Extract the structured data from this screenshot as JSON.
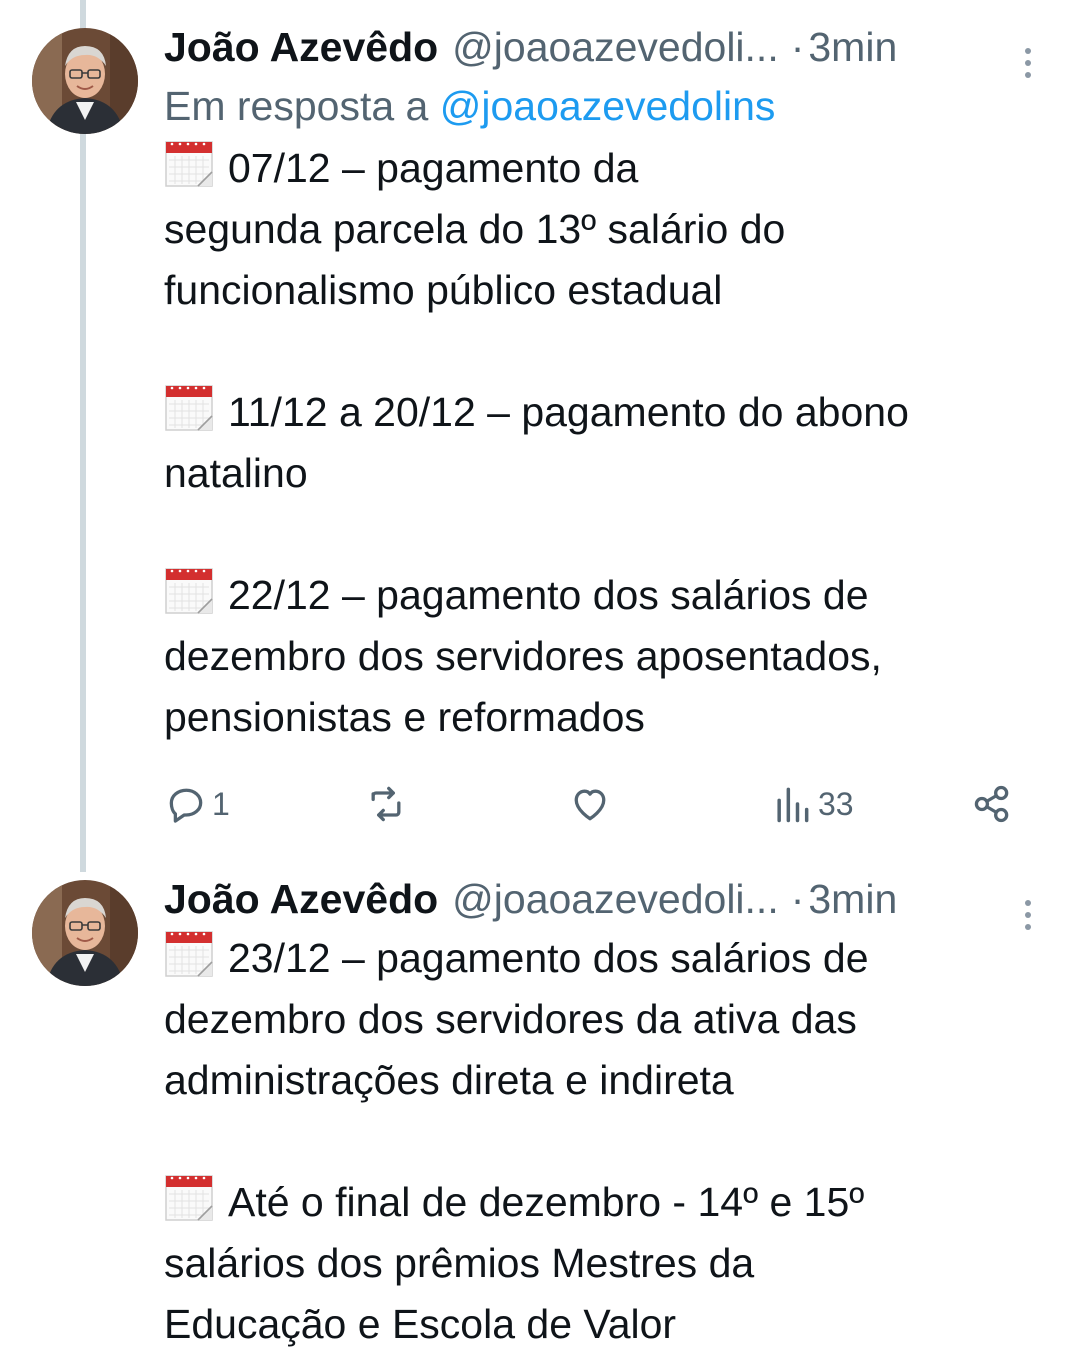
{
  "tweets": [
    {
      "author_name": "João Azevêdo",
      "handle": "@joaoazevedoli...",
      "separator": "·",
      "time": "3min",
      "reply_prefix": "Em resposta a",
      "reply_mention": "@joaoazevedolins",
      "lines": [
        "07/12 – pagamento da",
        "segunda parcela do 13º salário do",
        "funcionalismo público estadual",
        "",
        "11/12 a 20/12 – pagamento do abono",
        "natalino",
        "",
        "22/12 – pagamento dos salários de",
        "dezembro dos servidores aposentados,",
        "pensionistas e reformados"
      ],
      "actions": {
        "reply_count": "1",
        "retweet_count": "",
        "like_count": "",
        "views_count": "33"
      }
    },
    {
      "author_name": "João Azevêdo",
      "handle": "@joaoazevedoli...",
      "separator": "·",
      "time": "3min",
      "lines": [
        "23/12 – pagamento dos salários de",
        "dezembro dos servidores da ativa das",
        "administrações direta e indireta",
        "",
        "Até o final de dezembro - 14º e 15º",
        "salários dos prêmios Mestres da",
        "Educação e Escola de Valor"
      ]
    }
  ],
  "icons": {
    "calendar": "calendar-icon",
    "reply": "reply-icon",
    "retweet": "retweet-icon",
    "like": "heart-icon",
    "views": "views-icon",
    "share": "share-icon",
    "more": "more-vertical-icon"
  },
  "colors": {
    "text": "#0f1419",
    "secondary": "#536471",
    "link": "#1d9bf0",
    "thread_line": "#cfd9de",
    "calendar_red": "#d32f2f"
  }
}
